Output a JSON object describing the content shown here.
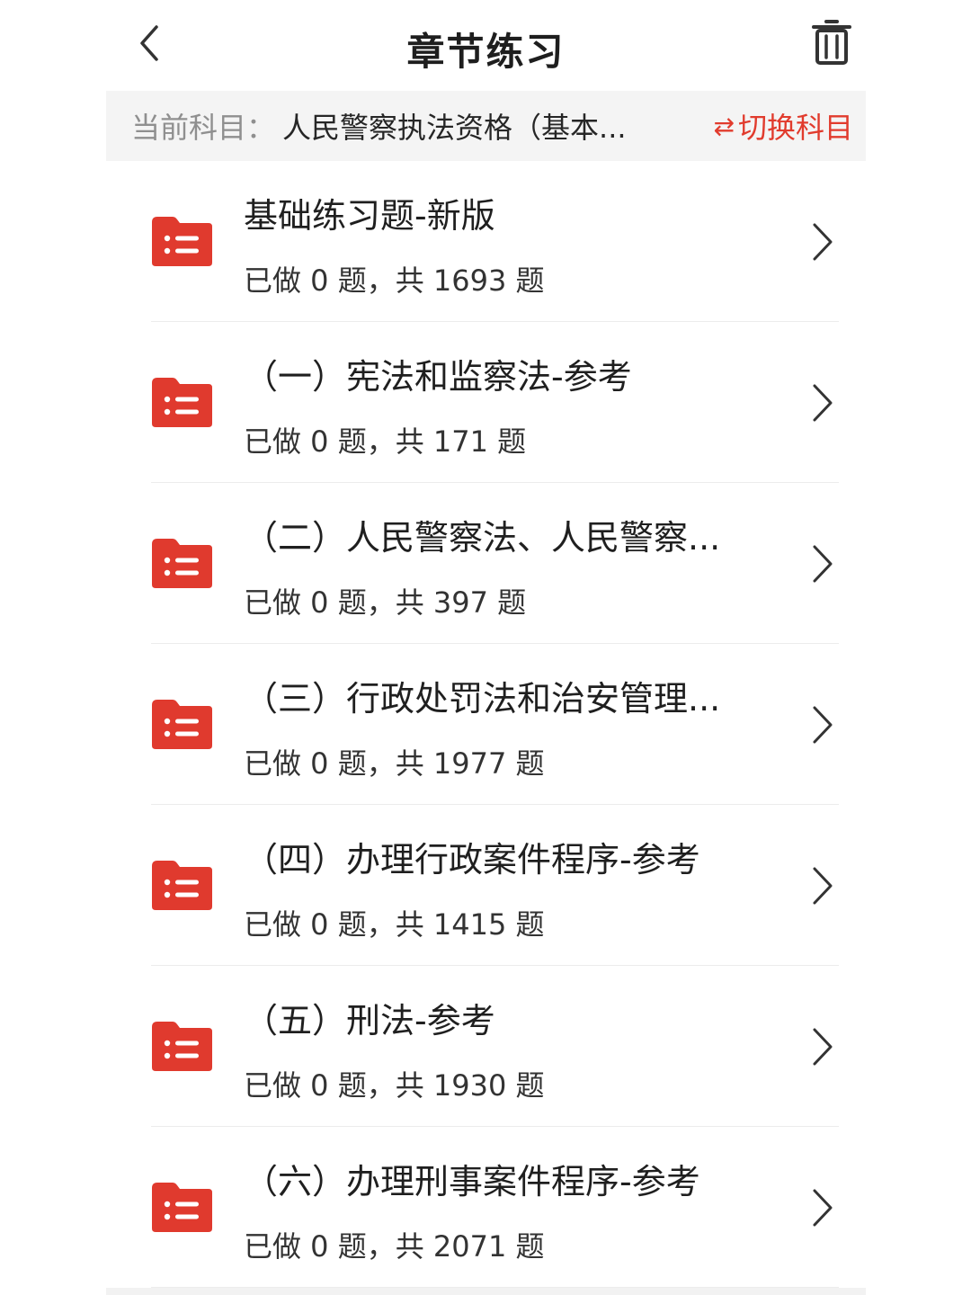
{
  "header": {
    "title": "章节练习",
    "back_icon": "chevron-left-icon",
    "trash_icon": "trash-icon"
  },
  "subject_bar": {
    "label": "当前科目：",
    "name": "人民警察执法资格（基本...",
    "switch_icon": "⇄",
    "switch_label": "切换科目"
  },
  "colors": {
    "accent": "#e13b2d",
    "folder": "#e03a2e"
  },
  "chapters": [
    {
      "title": "基础练习题-新版",
      "progress": "已做 0 题，共 1693 题"
    },
    {
      "title": "（一）宪法和监察法-参考",
      "progress": "已做 0 题，共 171 题"
    },
    {
      "title": "（二）人民警察法、人民警察...",
      "progress": "已做 0 题，共 397 题"
    },
    {
      "title": "（三）行政处罚法和治安管理...",
      "progress": "已做 0 题，共 1977 题"
    },
    {
      "title": "（四）办理行政案件程序-参考",
      "progress": "已做 0 题，共 1415 题"
    },
    {
      "title": "（五）刑法-参考",
      "progress": "已做 0 题，共 1930 题"
    },
    {
      "title": "（六）办理刑事案件程序-参考",
      "progress": "已做 0 题，共 2071 题"
    }
  ]
}
